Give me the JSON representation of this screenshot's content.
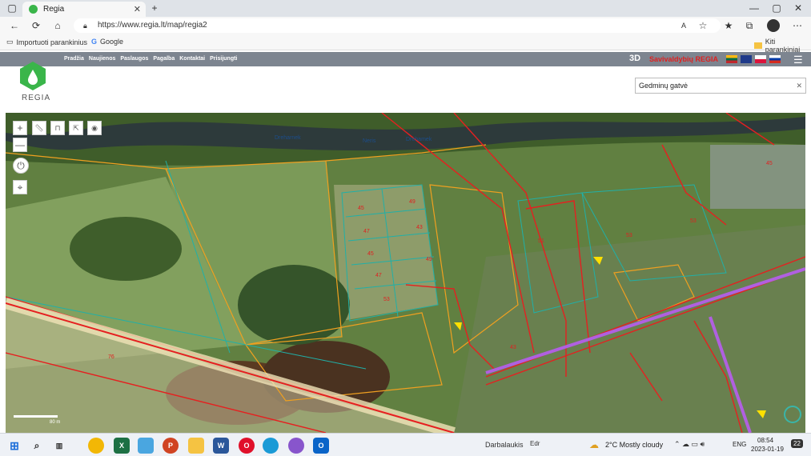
{
  "browser": {
    "tab_title": "Regia",
    "url": "https://www.regia.lt/map/regia2",
    "bookmarks": [
      "Importuoti parankinius",
      "Google"
    ],
    "other_bookmarks": "Kiti parankiniai"
  },
  "site": {
    "menu": [
      "Pradžia",
      "Naujienos",
      "Paslaugos",
      "Pagalba",
      "Kontaktai",
      "Prisijungti"
    ],
    "logo_text": "REGIA",
    "label_3d": "3D",
    "brand": "Savivaldybių REGIA",
    "search_value": "Gedminų gatvė"
  },
  "map": {
    "river_labels": [
      "Dreharnek",
      "Neris",
      "Drehamek"
    ],
    "parcel_numbers": [
      "45",
      "49",
      "47",
      "43",
      "45",
      "49",
      "47",
      "53",
      "51",
      "53",
      "53",
      "45",
      "43",
      "76"
    ],
    "scale_label": "80 m"
  },
  "taskbar": {
    "apps_label": "Darbalaukis",
    "edr_label": "Edr",
    "weather": "2°C  Mostly cloudy",
    "lang": "ENG",
    "time": "08:54",
    "date": "2023-01-19",
    "badge": "22"
  },
  "colors": {
    "accent": "#3ab54a",
    "brand_red": "#e02020",
    "header_gray": "#7d8590"
  }
}
